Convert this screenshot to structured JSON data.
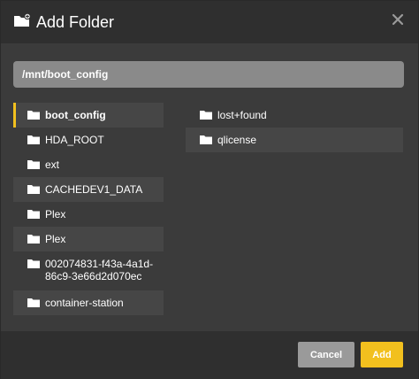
{
  "dialog": {
    "title": "Add Folder",
    "title_icon": "folder-add-icon",
    "close_icon": "close-icon"
  },
  "path": {
    "value": "/mnt/boot_config"
  },
  "left_items": [
    {
      "label": "boot_config",
      "icon": "folder-icon",
      "selected": true
    },
    {
      "label": "HDA_ROOT",
      "icon": "folder-icon"
    },
    {
      "label": "ext",
      "icon": "folder-icon"
    },
    {
      "label": "CACHEDEV1_DATA",
      "icon": "folder-icon"
    },
    {
      "label": "Plex",
      "icon": "folder-icon"
    },
    {
      "label": "Plex",
      "icon": "folder-icon"
    },
    {
      "label": "002074831-f43a-4a1d-86c9-3e66d2d070ec",
      "icon": "folder-icon"
    },
    {
      "label": "container-station",
      "icon": "folder-icon"
    }
  ],
  "right_items": [
    {
      "label": "lost+found",
      "icon": "folder-icon"
    },
    {
      "label": "qlicense",
      "icon": "folder-icon"
    }
  ],
  "footer": {
    "cancel_label": "Cancel",
    "add_label": "Add"
  },
  "colors": {
    "accent": "#f2c01e",
    "header_bg": "#2f2f2f",
    "body_bg": "#3b3b3b",
    "stripe_bg": "#464646",
    "path_bg": "#8a8a8a",
    "cancel_bg": "#9a9a9a"
  }
}
